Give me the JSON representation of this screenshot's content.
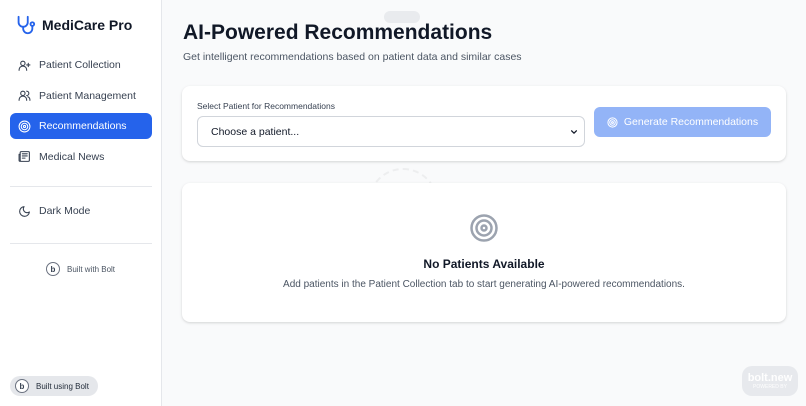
{
  "app": {
    "name": "MediCare Pro"
  },
  "sidebar": {
    "items": [
      {
        "label": "Patient Collection",
        "icon": "user-plus-icon",
        "active": false
      },
      {
        "label": "Patient Management",
        "icon": "users-icon",
        "active": false
      },
      {
        "label": "Recommendations",
        "icon": "target-icon",
        "active": true
      },
      {
        "label": "Medical News",
        "icon": "newspaper-icon",
        "active": false
      }
    ],
    "dark_mode_label": "Dark Mode",
    "built_with_label": "Built with Bolt",
    "built_using_label": "Built using Bolt"
  },
  "main": {
    "title": "AI-Powered Recommendations",
    "subtitle": "Get intelligent recommendations based on patient data and similar cases",
    "select_label": "Select Patient for Recommendations",
    "select_value": "Choose a patient...",
    "generate_button": "Generate Recommendations",
    "empty_title": "No Patients Available",
    "empty_description": "Add patients in the Patient Collection tab to start generating AI-powered recommendations."
  },
  "badge": {
    "brand": "bolt.new",
    "powered": "POWERED BY"
  },
  "colors": {
    "accent": "#2563eb",
    "button_disabled": "#93b4f7",
    "background": "#f9fafb"
  }
}
